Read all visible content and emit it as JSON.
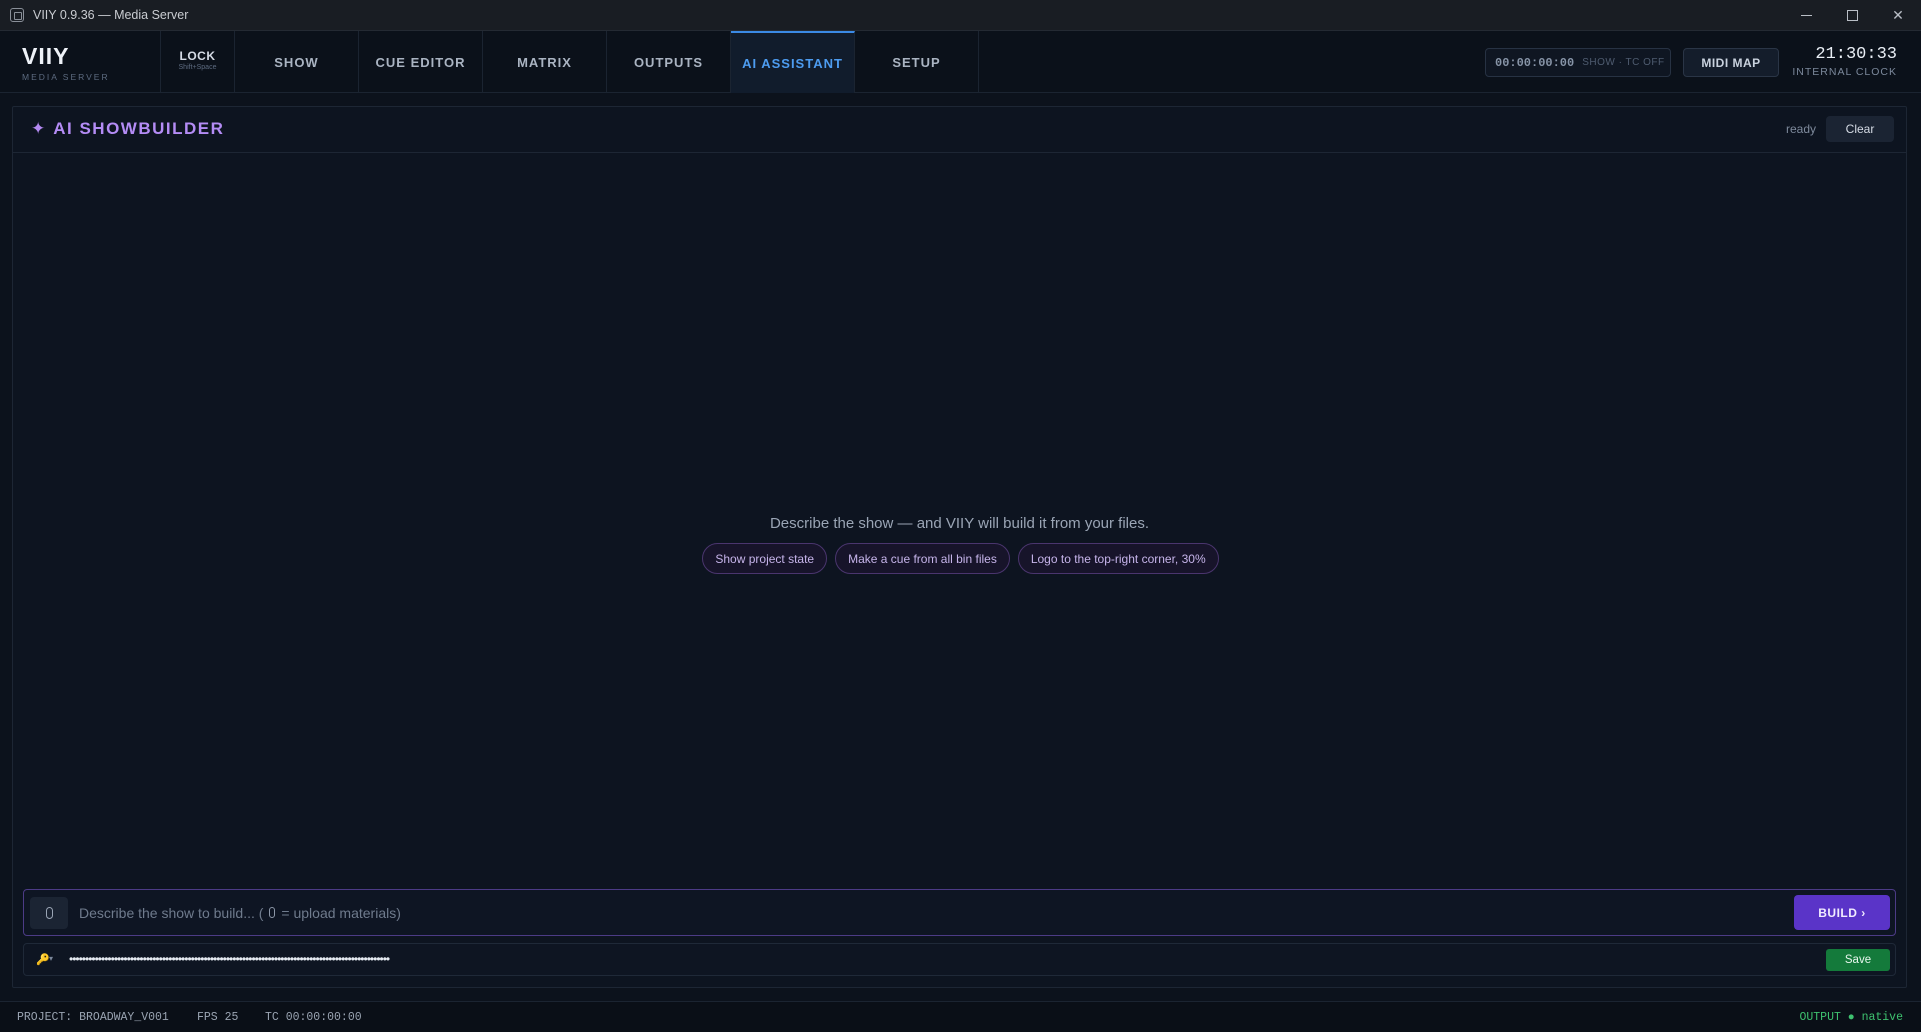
{
  "window": {
    "title": "VIIY 0.9.36 — Media Server",
    "minimize_glyph": "",
    "maximize_glyph": "",
    "close_glyph": "✕"
  },
  "brand": {
    "name": "VIIY",
    "subtitle": "MEDIA SERVER"
  },
  "lock": {
    "label": "LOCK",
    "hint": "Shift+Space"
  },
  "tabs": [
    {
      "label": "SHOW"
    },
    {
      "label": "CUE EDITOR"
    },
    {
      "label": "MATRIX"
    },
    {
      "label": "OUTPUTS"
    },
    {
      "label": "AI ASSISTANT",
      "active": true
    },
    {
      "label": "SETUP"
    }
  ],
  "timecode": {
    "value": "00:00:00:00",
    "state": "SHOW · TC OFF"
  },
  "midi_map": {
    "label": "MIDI MAP"
  },
  "clock": {
    "time": "21:30:33",
    "source": "INTERNAL CLOCK"
  },
  "panel": {
    "spark_glyph": "✦",
    "title": "AI SHOWBUILDER",
    "status": "ready",
    "clear_label": "Clear"
  },
  "empty_state": {
    "prompt": "Describe the show — and VIIY will build it from your files.",
    "suggestions": [
      "Show project state",
      "Make a cue from all bin files",
      "Logo to the top-right corner, 30%"
    ]
  },
  "composer": {
    "placeholder_before": "Describe the show to build... (",
    "placeholder_after": " = upload materials)",
    "build_label": "BUILD ›"
  },
  "api_key": {
    "key_glyph": "🔑",
    "dropdown_glyph": "▾",
    "masked_value": "••••••••••••••••••••••••••••••••••••••••••••••••••••••••••••••••••••••••••••••••••••••••••••••••••••",
    "save_label": "Save"
  },
  "statusbar": {
    "project": "PROJECT: BROADWAY_V001",
    "fps": "FPS 25",
    "tc": "TC 00:00:00:00",
    "output": "OUTPUT ● native"
  },
  "colors": {
    "accent_blue": "#4d9cf0",
    "accent_purple": "#b48cf5",
    "build_purple": "#5a34c8",
    "save_green": "#147a3b",
    "output_green": "#3ec26f"
  }
}
